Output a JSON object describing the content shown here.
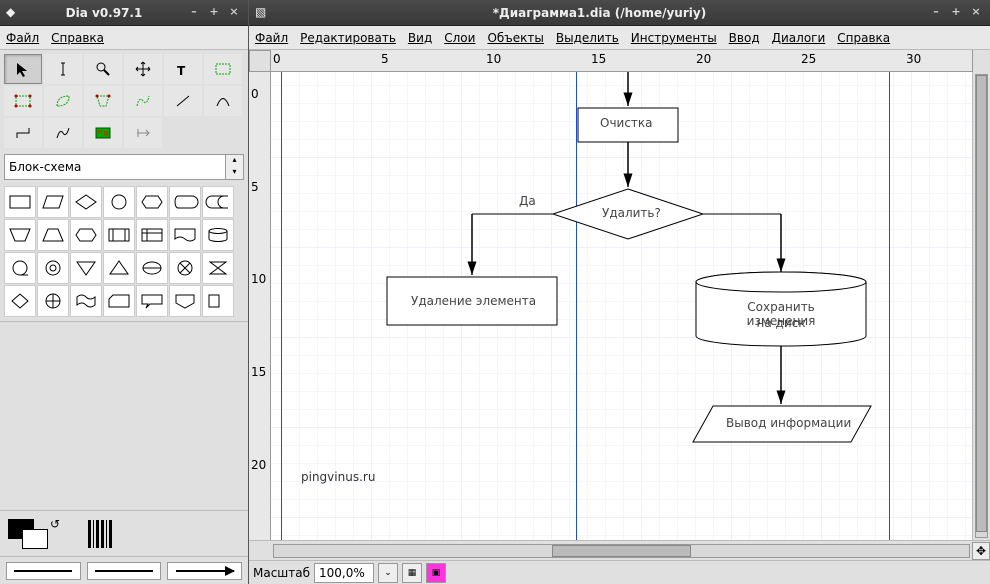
{
  "toolbox": {
    "title": "Dia v0.97.1",
    "menu": {
      "file": "Файл",
      "help": "Справка"
    },
    "sheet_name": "Блок-схема"
  },
  "diagram": {
    "title": "*Диаграмма1.dia (/home/yuriy)",
    "menu": {
      "file": "Файл",
      "edit": "Редактировать",
      "view": "Вид",
      "layers": "Слои",
      "objects": "Объекты",
      "select": "Выделить",
      "tools": "Инструменты",
      "input": "Ввод",
      "dialogs": "Диалоги",
      "help": "Справка"
    }
  },
  "ruler_h": [
    "0",
    "5",
    "10",
    "15",
    "20",
    "25",
    "30"
  ],
  "ruler_v": [
    "0",
    "5",
    "10",
    "15",
    "20"
  ],
  "nodes": {
    "clean": {
      "label": "Очистка"
    },
    "delete": {
      "label": "Удалить?"
    },
    "yes": {
      "label": "Да"
    },
    "del_el": {
      "label": "Удаление элемента"
    },
    "save": {
      "label1": "Сохранить изменения",
      "label2": "на диск"
    },
    "output": {
      "label": "Вывод информации"
    }
  },
  "watermark": "pingvinus.ru",
  "status": {
    "zoom_label": "Масштаб",
    "zoom_value": "100,0%"
  }
}
